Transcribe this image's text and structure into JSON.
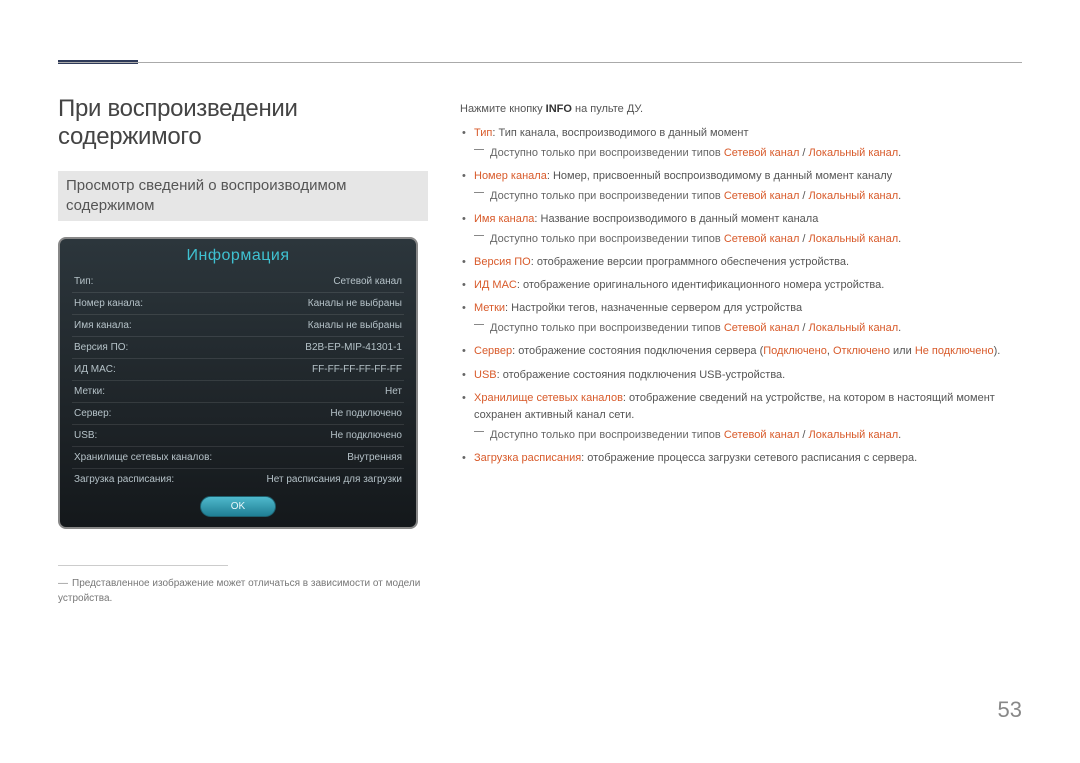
{
  "header": {
    "h1": "При воспроизведении содержимого",
    "h2": "Просмотр сведений о воспроизводимом содержимом"
  },
  "panel": {
    "title": "Информация",
    "rows": [
      {
        "label": "Тип:",
        "value": "Сетевой канал"
      },
      {
        "label": "Номер канала:",
        "value": "Каналы не выбраны"
      },
      {
        "label": "Имя канала:",
        "value": "Каналы не выбраны"
      },
      {
        "label": "Версия ПО:",
        "value": "B2B-EP-MIP-41301-1"
      },
      {
        "label": "ИД MAC:",
        "value": "FF-FF-FF-FF-FF-FF"
      },
      {
        "label": "Метки:",
        "value": "Нет"
      },
      {
        "label": "Сервер:",
        "value": "Не подключено"
      },
      {
        "label": "USB:",
        "value": "Не подключено"
      },
      {
        "label": "Хранилище сетевых каналов:",
        "value": "Внутренняя"
      },
      {
        "label": "Загрузка расписания:",
        "value": "Нет расписания для загрузки"
      }
    ],
    "ok": "OK"
  },
  "footnote": {
    "text": "Представленное изображение может отличаться в зависимости от модели устройства."
  },
  "right": {
    "intro_pre": "Нажмите кнопку ",
    "intro_strong": "INFO",
    "intro_post": " на пульте ДУ.",
    "avail_pre": "Доступно только при воспроизведении типов ",
    "avail_net": "Сетевой канал",
    "avail_sep": " / ",
    "avail_loc": "Локальный канал",
    "avail_end": ".",
    "items": [
      {
        "term": "Тип",
        "desc": ": Тип канала, воспроизводимого в данный момент",
        "avail": true
      },
      {
        "term": "Номер канала",
        "desc": ": Номер, присвоенный воспроизводимому в данный момент каналу",
        "avail": true
      },
      {
        "term": "Имя канала",
        "desc": ": Название воспроизводимого в данный момент канала",
        "avail": true
      },
      {
        "term": "Версия ПО",
        "desc": ": отображение версии программного обеспечения устройства.",
        "avail": false
      },
      {
        "term": "ИД MAC",
        "desc": ": отображение оригинального идентификационного номера устройства.",
        "avail": false
      },
      {
        "term": "Метки",
        "desc": ": Настройки тегов, назначенные сервером для устройства",
        "avail": true
      },
      {
        "term": "Сервер",
        "desc_pre": ": отображение состояния подключения сервера (",
        "s1": "Подключено",
        "c1": ", ",
        "s2": "Отключено",
        "c2": " или ",
        "s3": "Не подключено",
        "desc_post": ").",
        "server": true
      },
      {
        "term": "USB",
        "desc": ": отображение состояния подключения USB-устройства.",
        "avail": false
      },
      {
        "term": "Хранилище сетевых каналов",
        "desc": ": отображение сведений на устройстве, на котором в настоящий момент сохранен активный канал сети.",
        "avail": true
      },
      {
        "term": "Загрузка расписания",
        "desc": ": отображение процесса загрузки сетевого расписания с сервера.",
        "avail": false
      }
    ]
  },
  "page": "53"
}
